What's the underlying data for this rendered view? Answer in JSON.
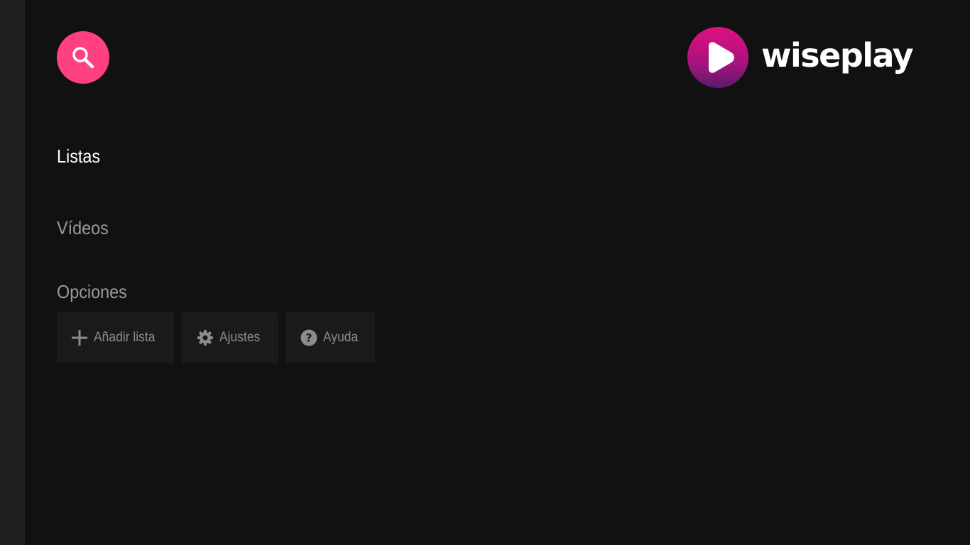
{
  "app": {
    "logo_text": "wiseplay",
    "brand_color": "#ff4081"
  },
  "search": {
    "icon": "search-icon"
  },
  "sections": {
    "lists_title": "Listas",
    "videos_title": "Vídeos",
    "options_title": "Opciones"
  },
  "options": [
    {
      "label": "Añadir lista",
      "icon": "plus-icon"
    },
    {
      "label": "Ajustes",
      "icon": "gear-icon"
    },
    {
      "label": "Ayuda",
      "icon": "help-circle-icon"
    }
  ]
}
